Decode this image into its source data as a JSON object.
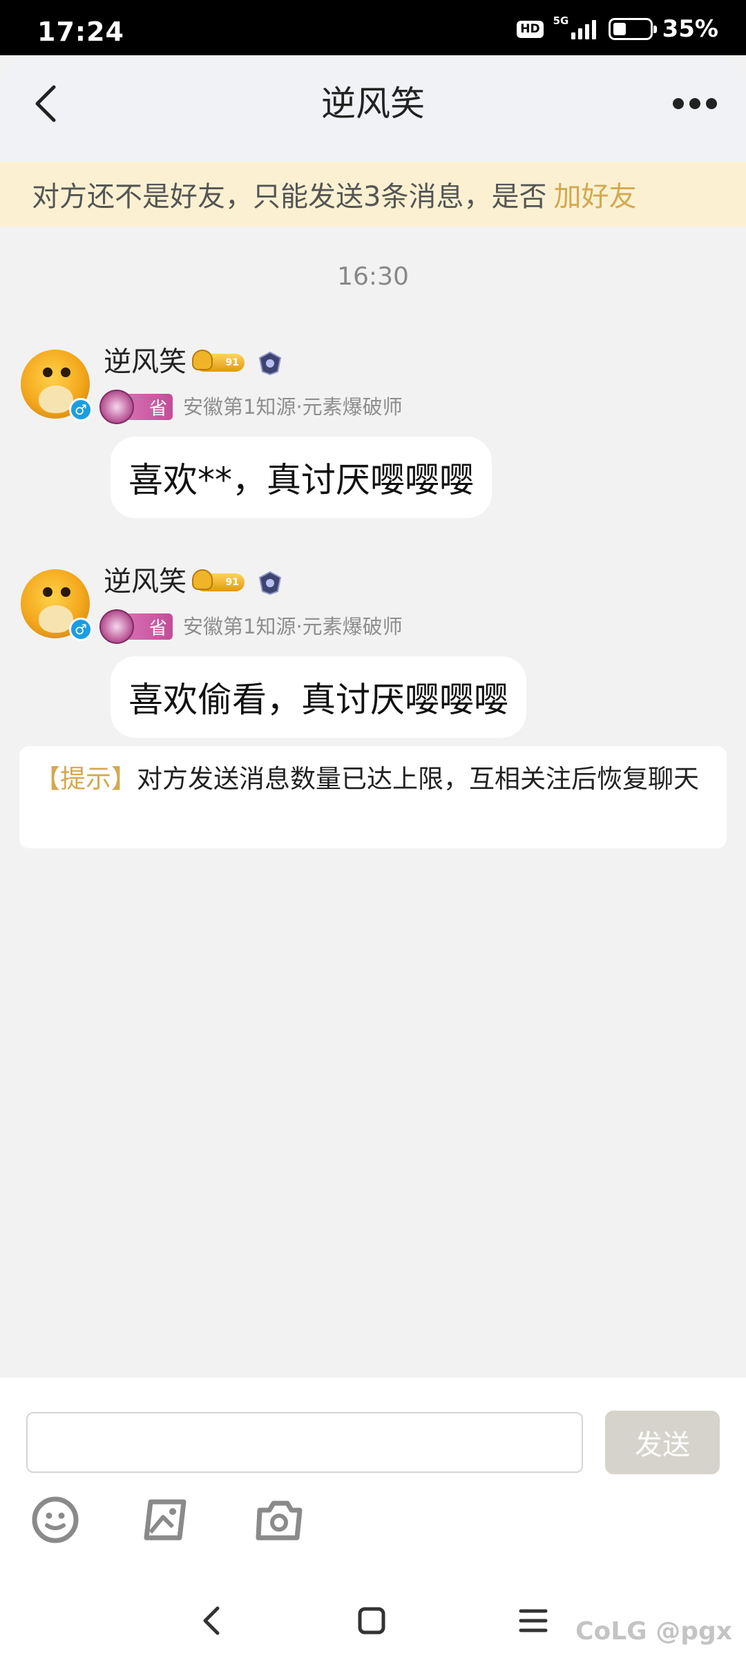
{
  "status_bar": {
    "time": "17:24",
    "hd": "HD",
    "network": "5G",
    "battery_percent": "35%",
    "battery_level": 0.35
  },
  "header": {
    "title": "逆风笑",
    "back_icon": "chevron-left-icon",
    "more_icon": "more-dots-icon"
  },
  "notice": {
    "text": "对方还不是好友，只能发送3条消息，是否",
    "link": "加好友",
    "link_color": "#d4a850"
  },
  "chat": {
    "timestamp": "16:30",
    "messages": [
      {
        "sender_name": "逆风笑",
        "level": "91",
        "province_badge": "省",
        "sender_title": "安徽第1知源·元素爆破师",
        "gender": "♂",
        "text": "喜欢**，真讨厌嘤嘤嘤"
      },
      {
        "sender_name": "逆风笑",
        "level": "91",
        "province_badge": "省",
        "sender_title": "安徽第1知源·元素爆破师",
        "gender": "♂",
        "text": "喜欢偷看，真讨厌嘤嘤嘤"
      }
    ],
    "tip": {
      "label": "【提示】",
      "text": "对方发送消息数量已达上限，互相关注后恢复聊天"
    }
  },
  "composer": {
    "input_value": "",
    "send_label": "发送",
    "tools": [
      "emoji-icon",
      "image-icon",
      "camera-icon"
    ]
  },
  "nav": {
    "buttons": [
      "back-icon",
      "home-icon",
      "menu-icon"
    ]
  },
  "watermark": "CoLG @pgx"
}
